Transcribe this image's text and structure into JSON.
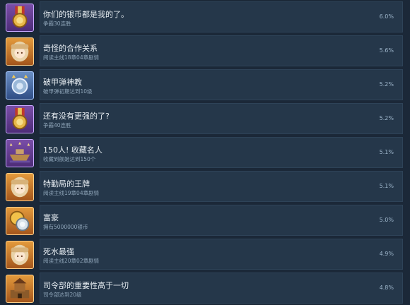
{
  "achievements": [
    {
      "title": "你们的银币都是我的了。",
      "desc": "争霸30连胜",
      "percent": "6.0%",
      "icon": "medal-icon",
      "color": "purple"
    },
    {
      "title": "奇怪的合作关系",
      "desc": "阅读主线18章04章剧情",
      "percent": "5.6%",
      "icon": "character-portrait-icon",
      "color": "orange"
    },
    {
      "title": "破甲弹神教",
      "desc": "破甲弹初期达到10级",
      "percent": "5.2%",
      "icon": "shell-icon",
      "color": "blue"
    },
    {
      "title": "还有没有更强的了?",
      "desc": "争霸40连胜",
      "percent": "5.2%",
      "icon": "medal-icon",
      "color": "purple"
    },
    {
      "title": "150人! 收藏名人",
      "desc": "收藏到舰姬达到150个",
      "percent": "5.1%",
      "icon": "ship-icon",
      "color": "purple"
    },
    {
      "title": "特勤局的王牌",
      "desc": "阅读主线19章04章剧情",
      "percent": "5.1%",
      "icon": "character-portrait-icon",
      "color": "orange"
    },
    {
      "title": "富豪",
      "desc": "拥有5000000银币",
      "percent": "5.0%",
      "icon": "coins-icon",
      "color": "orange"
    },
    {
      "title": "死水最强",
      "desc": "阅读主线20章02章剧情",
      "percent": "4.9%",
      "icon": "character-portrait-icon",
      "color": "orange"
    },
    {
      "title": "司令部的重要性高于一切",
      "desc": "司令部达到20级",
      "percent": "4.8%",
      "icon": "headquarters-icon",
      "color": "orange"
    }
  ]
}
